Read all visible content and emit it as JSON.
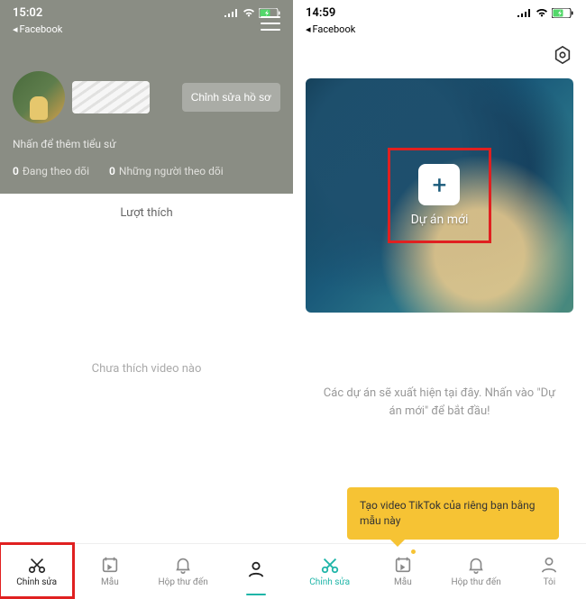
{
  "left": {
    "status_time": "15:02",
    "back_app": "Facebook",
    "name_card": "",
    "edit_profile": "Chỉnh sửa hồ sơ",
    "bio_hint": "Nhấn để thêm tiểu sử",
    "following_count": "0",
    "following_label": "Đang theo dõi",
    "followers_count": "0",
    "followers_label": "Những người theo dõi",
    "likes_tab": "Lượt thích",
    "empty_message": "Chưa thích video nào",
    "nav": {
      "edit": "Chỉnh sửa",
      "template": "Mẫu",
      "inbox": "Hộp thư đến",
      "profile": ""
    }
  },
  "right": {
    "status_time": "14:59",
    "back_app": "Facebook",
    "new_project_label": "Dự án mới",
    "hint_text": "Các dự án sẽ xuất hiện tại đây. Nhấn vào \"Dự án mới\" để bắt đầu!",
    "tooltip": "Tạo video TikTok của riêng bạn bằng mẫu này",
    "nav": {
      "edit": "Chỉnh sửa",
      "template": "Mẫu",
      "inbox": "Hộp thư đến",
      "profile": "Tôi"
    }
  }
}
